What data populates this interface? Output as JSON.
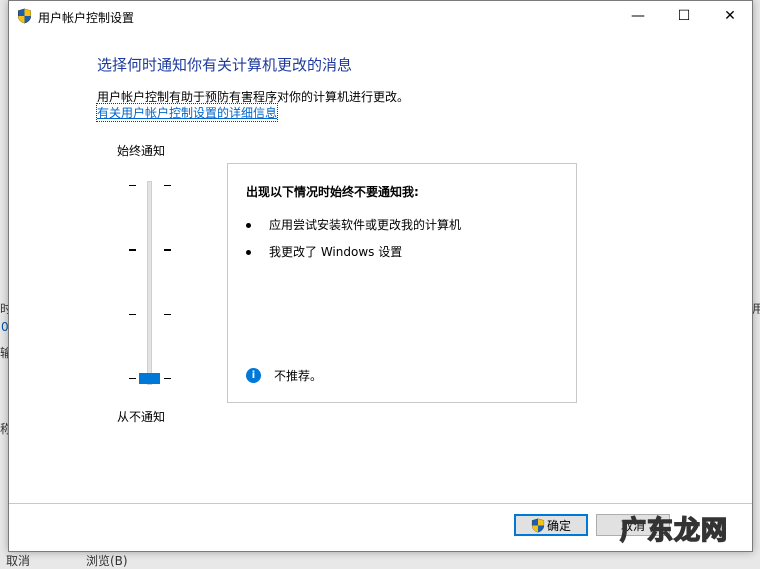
{
  "window": {
    "title": "用户帐户控制设置",
    "minimize": "—",
    "maximize": "☐",
    "close": "✕"
  },
  "main": {
    "heading": "选择何时通知你有关计算机更改的消息",
    "description": "用户帐户控制有助于预防有害程序对你的计算机进行更改。",
    "link": "有关用户帐户控制设置的详细信息"
  },
  "slider": {
    "top_label": "始终通知",
    "bottom_label": "从不通知",
    "levels": 4,
    "selected_level": 1
  },
  "panel": {
    "title": "出现以下情况时始终不要通知我:",
    "bullets": [
      "应用尝试安装软件或更改我的计算机",
      "我更改了 Windows 设置"
    ],
    "info": "不推荐。"
  },
  "buttons": {
    "ok": "确定",
    "cancel": "取消"
  },
  "background": {
    "left_fragments": [
      "时",
      "0",
      "输",
      "称"
    ],
    "right_fragment": "用",
    "bottom_left": "取消",
    "bottom_mid": "浏览(B)"
  },
  "watermark": "广东龙网"
}
